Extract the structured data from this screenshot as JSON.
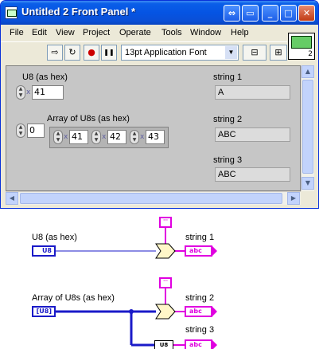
{
  "window": {
    "title": "Untitled 2 Front Panel *",
    "minimize": "_",
    "maximize": "□",
    "close": "✕",
    "extra": "⇔",
    "restore": "▭"
  },
  "menu": [
    "File",
    "Edit",
    "View",
    "Project",
    "Operate",
    "Tools",
    "Window",
    "Help"
  ],
  "toolbar": {
    "run": "⇨",
    "run_continuous": "↻",
    "abort": "●",
    "pause": "❚❚",
    "font": "13pt Application Font",
    "align": "⊟",
    "distribute": "⊞"
  },
  "vi_icon": {
    "number": "2"
  },
  "front_panel": {
    "u8_label": "U8 (as hex)",
    "u8_radix": "x",
    "u8_value": "41",
    "array_label": "Array of U8s (as hex)",
    "array_index": "0",
    "array_values": [
      "41",
      "42",
      "43"
    ],
    "string1_label": "string 1",
    "string1_value": "A",
    "string2_label": "string 2",
    "string2_value": "ABC",
    "string3_label": "string 3",
    "string3_value": "ABC"
  },
  "block_diagram": {
    "u8_label": "U8 (as hex)",
    "u8_type": "U8",
    "array_label": "Array of U8s (as hex)",
    "array_type": "[U8]",
    "string1_label": "string 1",
    "string2_label": "string 2",
    "string3_label": "string 3",
    "string_type": "abc",
    "byte_array_node": "U8"
  },
  "colors": {
    "numeric_wire": "#1a1ac8",
    "string_wire": "#e000e0",
    "titlebar": "#0554e3"
  }
}
